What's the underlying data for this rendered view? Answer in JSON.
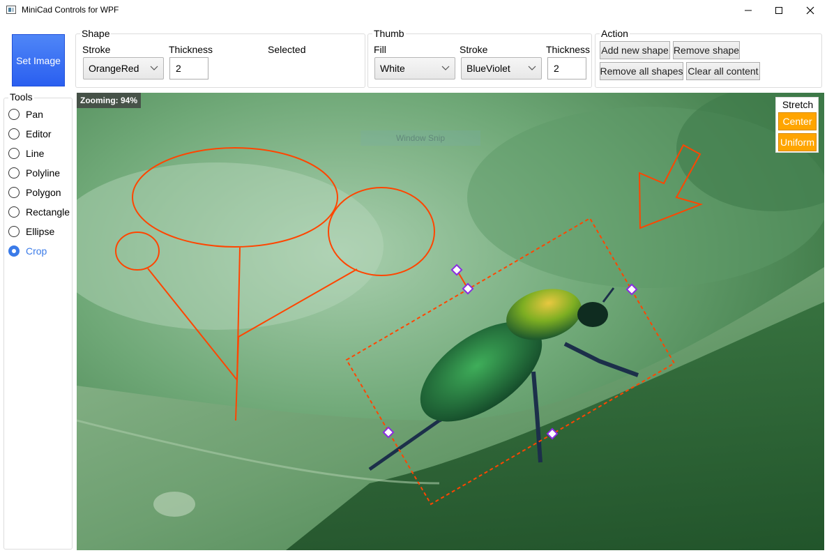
{
  "window": {
    "title": "MiniCad Controls for WPF"
  },
  "set_image_label": "Set Image",
  "shape_group": {
    "legend": "Shape",
    "stroke_label": "Stroke",
    "stroke_value": "OrangeRed",
    "thickness_label": "Thickness",
    "thickness_value": "2",
    "selected_label": "Selected"
  },
  "thumb_group": {
    "legend": "Thumb",
    "fill_label": "Fill",
    "fill_value": "White",
    "stroke_label": "Stroke",
    "stroke_value": "BlueViolet",
    "thickness_label": "Thickness",
    "thickness_value": "2"
  },
  "action_group": {
    "legend": "Action",
    "add_new_shape": "Add new shape",
    "remove_shape": "Remove shape",
    "remove_all_shapes": "Remove all shapes",
    "clear_all_content": "Clear all content"
  },
  "tools": {
    "legend": "Tools",
    "items": [
      {
        "label": "Pan",
        "checked": false
      },
      {
        "label": "Editor",
        "checked": false
      },
      {
        "label": "Line",
        "checked": false
      },
      {
        "label": "Polyline",
        "checked": false
      },
      {
        "label": "Polygon",
        "checked": false
      },
      {
        "label": "Rectangle",
        "checked": false
      },
      {
        "label": "Ellipse",
        "checked": false
      },
      {
        "label": "Crop",
        "checked": true
      }
    ]
  },
  "canvas": {
    "zoom_text": "Zooming: 94%",
    "snip_text": "Window Snip"
  },
  "stretch": {
    "title": "Stretch",
    "center": "Center",
    "uniform": "Uniform"
  },
  "colors": {
    "shape_stroke": "#ff4500",
    "thumb_stroke": "#8a2be2",
    "thumb_fill": "#ffffff",
    "accent_blue": "#3b7be8",
    "stretch_orange": "#ffa500"
  }
}
